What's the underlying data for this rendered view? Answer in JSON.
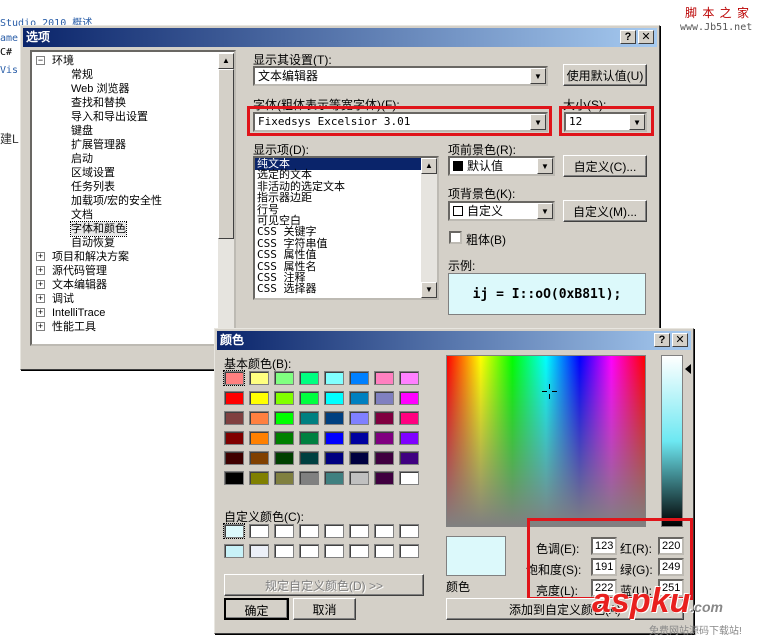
{
  "background": {
    "line1": "Studio 2010 概述",
    "line2": "ame",
    "line3": "C#",
    "line4": "Vis",
    "line5": "建L",
    "site_title": "脚 本 之 家",
    "site_url": "www.Jb51.net",
    "watermark_main": "aspku",
    "watermark_tld": ".com",
    "watermark_sub": "免费网站源码下载站!"
  },
  "options_dialog": {
    "title": "选项",
    "help": "?",
    "close": "✕",
    "tree": [
      {
        "label": "环境",
        "level": 0,
        "expander": "−"
      },
      {
        "label": "常规",
        "level": 1
      },
      {
        "label": "Web 浏览器",
        "level": 1
      },
      {
        "label": "查找和替换",
        "level": 1
      },
      {
        "label": "导入和导出设置",
        "level": 1
      },
      {
        "label": "键盘",
        "level": 1
      },
      {
        "label": "扩展管理器",
        "level": 1
      },
      {
        "label": "启动",
        "level": 1
      },
      {
        "label": "区域设置",
        "level": 1
      },
      {
        "label": "任务列表",
        "level": 1
      },
      {
        "label": "加载项/宏的安全性",
        "level": 1
      },
      {
        "label": "文档",
        "level": 1
      },
      {
        "label": "字体和颜色",
        "level": 1,
        "selected": true
      },
      {
        "label": "自动恢复",
        "level": 1
      },
      {
        "label": "项目和解决方案",
        "level": 0,
        "expander": "+"
      },
      {
        "label": "源代码管理",
        "level": 0,
        "expander": "+"
      },
      {
        "label": "文本编辑器",
        "level": 0,
        "expander": "+"
      },
      {
        "label": "调试",
        "level": 0,
        "expander": "+"
      },
      {
        "label": "IntelliTrace",
        "level": 0,
        "expander": "+"
      },
      {
        "label": "性能工具",
        "level": 0,
        "expander": "+"
      }
    ],
    "show_settings_label": "显示其设置(T):",
    "show_settings_value": "文本编辑器",
    "use_defaults": "使用默认值(U)",
    "font_label": "字体(粗体表示等宽字体)(F):",
    "font_value": "Fixedsys Excelsior 3.01",
    "size_label": "大小(S):",
    "size_value": "12",
    "display_items_label": "显示项(D):",
    "display_items": [
      "纯文本",
      "选定的文本",
      "非活动的选定文本",
      "指示器边距",
      "行号",
      "可见空白",
      "CSS 关键字",
      "CSS 字符串值",
      "CSS 属性值",
      "CSS 属性名",
      "CSS 注释",
      "CSS 选择器"
    ],
    "fg_label": "项前景色(R):",
    "fg_value": "默认值",
    "fg_custom": "自定义(C)...",
    "bg_label": "项背景色(K):",
    "bg_value": "自定义",
    "bg_custom": "自定义(M)...",
    "bold_label": "粗体(B)",
    "sample_label": "示例:",
    "sample_text": "ij = I::oO(0xB81l);"
  },
  "color_dialog": {
    "title": "颜色",
    "help": "?",
    "close": "✕",
    "basic_colors_label": "基本颜色(B):",
    "basic_colors": [
      "#ff8080",
      "#ffff80",
      "#80ff80",
      "#00ff80",
      "#80ffff",
      "#0080ff",
      "#ff80c0",
      "#ff80ff",
      "#ff0000",
      "#ffff00",
      "#80ff00",
      "#00ff40",
      "#00ffff",
      "#0080c0",
      "#8080c0",
      "#ff00ff",
      "#804040",
      "#ff8040",
      "#00ff00",
      "#008080",
      "#004080",
      "#8080ff",
      "#800040",
      "#ff0080",
      "#800000",
      "#ff8000",
      "#008000",
      "#008040",
      "#0000ff",
      "#0000a0",
      "#800080",
      "#8000ff",
      "#400000",
      "#804000",
      "#004000",
      "#004040",
      "#000080",
      "#000040",
      "#400040",
      "#400080",
      "#000000",
      "#808000",
      "#808040",
      "#808080",
      "#408080",
      "#c0c0c0",
      "#400040",
      "#ffffff"
    ],
    "custom_colors_label": "自定义颜色(C):",
    "custom_colors": [
      "#ddf9fb",
      "#ffffff",
      "#ffffff",
      "#ffffff",
      "#ffffff",
      "#ffffff",
      "#ffffff",
      "#ffffff",
      "#c8f2f8",
      "#ecf0f8",
      "#ffffff",
      "#ffffff",
      "#ffffff",
      "#ffffff",
      "#ffffff",
      "#ffffff"
    ],
    "define_custom": "规定自定义颜色(D) >>",
    "ok": "确定",
    "cancel": "取消",
    "preview_label": "颜色",
    "hue_label": "色调(E):",
    "hue": "123",
    "sat_label": "饱和度(S):",
    "sat": "191",
    "lum_label": "亮度(L):",
    "lum": "222",
    "red_label": "红(R):",
    "red": "220",
    "green_label": "绿(G):",
    "green": "249",
    "blue_label": "蓝(U):",
    "blue": "251",
    "add_custom": "添加到自定义颜色(A)",
    "selected_color": "#dcf9fb"
  }
}
